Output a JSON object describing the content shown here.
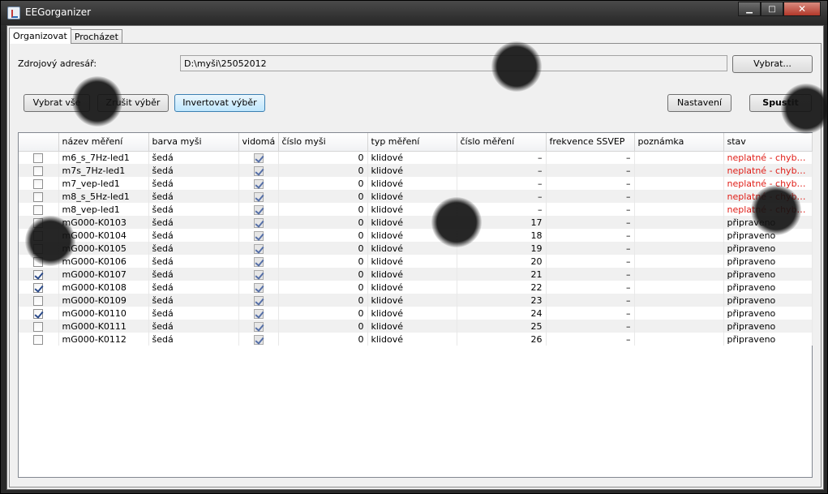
{
  "window": {
    "title": "EEGorganizer",
    "controls": {
      "minimize": "▁",
      "maximize": "□",
      "close": "✕"
    }
  },
  "tabs": [
    {
      "label": "Organizovat",
      "active": true
    },
    {
      "label": "Procházet",
      "active": false
    }
  ],
  "source": {
    "label": "Zdrojový adresář:",
    "path": "D:\\myši\\25052012",
    "browse_label": "Vybrat..."
  },
  "actions": {
    "select_all": "Vybrat vše",
    "deselect": "Zrušit výběr",
    "invert": "Invertovat výběr",
    "settings": "Nastavení",
    "run": "Spustit"
  },
  "table": {
    "columns": [
      "",
      "název měření",
      "barva myši",
      "vidomá",
      "číslo myši",
      "typ měření",
      "číslo měření",
      "frekvence SSVEP",
      "poznámka",
      "stav"
    ],
    "rows": [
      {
        "selected": false,
        "name": "m6_s_7Hz-led1",
        "color": "šedá",
        "sighted": true,
        "mouse_no": "0",
        "type": "klidové",
        "measure_no": "–",
        "ssvep": "–",
        "note": "",
        "status": "neplatné - chybí E...",
        "error": true
      },
      {
        "selected": false,
        "name": "m7s_7Hz-led1",
        "color": "šedá",
        "sighted": true,
        "mouse_no": "0",
        "type": "klidové",
        "measure_no": "–",
        "ssvep": "–",
        "note": "",
        "status": "neplatné - chybí E...",
        "error": true
      },
      {
        "selected": false,
        "name": "m7_vep-led1",
        "color": "šedá",
        "sighted": true,
        "mouse_no": "0",
        "type": "klidové",
        "measure_no": "–",
        "ssvep": "–",
        "note": "",
        "status": "neplatné - chybí E...",
        "error": true
      },
      {
        "selected": false,
        "name": "m8_s_5Hz-led1",
        "color": "šedá",
        "sighted": true,
        "mouse_no": "0",
        "type": "klidové",
        "measure_no": "–",
        "ssvep": "–",
        "note": "",
        "status": "neplatné - chybí E...",
        "error": true
      },
      {
        "selected": false,
        "name": "m8_vep-led1",
        "color": "šedá",
        "sighted": true,
        "mouse_no": "0",
        "type": "klidové",
        "measure_no": "–",
        "ssvep": "–",
        "note": "",
        "status": "neplatné - chybí E...",
        "error": true
      },
      {
        "selected": false,
        "name": "mG000-K0103",
        "color": "šedá",
        "sighted": true,
        "mouse_no": "0",
        "type": "klidové",
        "measure_no": "17",
        "ssvep": "–",
        "note": "",
        "status": "připraveno",
        "error": false
      },
      {
        "selected": false,
        "name": "mG000-K0104",
        "color": "šedá",
        "sighted": true,
        "mouse_no": "0",
        "type": "klidové",
        "measure_no": "18",
        "ssvep": "–",
        "note": "",
        "status": "připraveno",
        "error": false
      },
      {
        "selected": false,
        "name": "mG000-K0105",
        "color": "šedá",
        "sighted": true,
        "mouse_no": "0",
        "type": "klidové",
        "measure_no": "19",
        "ssvep": "–",
        "note": "",
        "status": "připraveno",
        "error": false
      },
      {
        "selected": false,
        "name": "mG000-K0106",
        "color": "šedá",
        "sighted": true,
        "mouse_no": "0",
        "type": "klidové",
        "measure_no": "20",
        "ssvep": "–",
        "note": "",
        "status": "připraveno",
        "error": false
      },
      {
        "selected": true,
        "name": "mG000-K0107",
        "color": "šedá",
        "sighted": true,
        "mouse_no": "0",
        "type": "klidové",
        "measure_no": "21",
        "ssvep": "–",
        "note": "",
        "status": "připraveno",
        "error": false
      },
      {
        "selected": true,
        "name": "mG000-K0108",
        "color": "šedá",
        "sighted": true,
        "mouse_no": "0",
        "type": "klidové",
        "measure_no": "22",
        "ssvep": "–",
        "note": "",
        "status": "připraveno",
        "error": false
      },
      {
        "selected": false,
        "name": "mG000-K0109",
        "color": "šedá",
        "sighted": true,
        "mouse_no": "0",
        "type": "klidové",
        "measure_no": "23",
        "ssvep": "–",
        "note": "",
        "status": "připraveno",
        "error": false
      },
      {
        "selected": true,
        "name": "mG000-K0110",
        "color": "šedá",
        "sighted": true,
        "mouse_no": "0",
        "type": "klidové",
        "measure_no": "24",
        "ssvep": "–",
        "note": "",
        "status": "připraveno",
        "error": false
      },
      {
        "selected": false,
        "name": "mG000-K0111",
        "color": "šedá",
        "sighted": true,
        "mouse_no": "0",
        "type": "klidové",
        "measure_no": "25",
        "ssvep": "–",
        "note": "",
        "status": "připraveno",
        "error": false
      },
      {
        "selected": false,
        "name": "mG000-K0112",
        "color": "šedá",
        "sighted": true,
        "mouse_no": "0",
        "type": "klidové",
        "measure_no": "26",
        "ssvep": "–",
        "note": "",
        "status": "připraveno",
        "error": false
      }
    ]
  },
  "colors": {
    "error_text": "#e0201a",
    "title_bar": "#262626",
    "panel_bg": "#f0f0f0"
  }
}
